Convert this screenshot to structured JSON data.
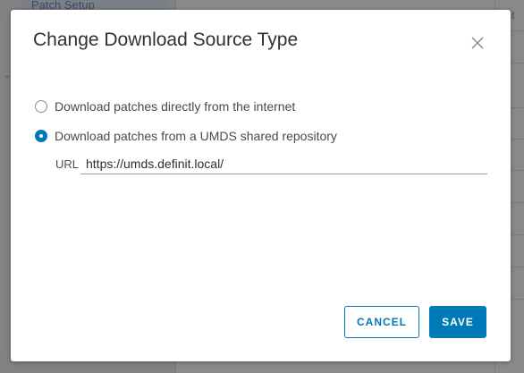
{
  "background": {
    "sidebar_item": "Patch Setup",
    "column_header_fragment": "nit"
  },
  "dialog": {
    "title": "Change Download Source Type",
    "close_icon": "close-icon",
    "options": [
      {
        "label": "Download patches directly from the internet",
        "selected": false
      },
      {
        "label": "Download patches from a UMDS shared repository",
        "selected": true
      }
    ],
    "url_label": "URL",
    "url_value": "https://umds.definit.local/",
    "cancel_label": "CANCEL",
    "save_label": "SAVE"
  },
  "colors": {
    "accent": "#0079b8",
    "overlay": "#8a8a8a"
  }
}
